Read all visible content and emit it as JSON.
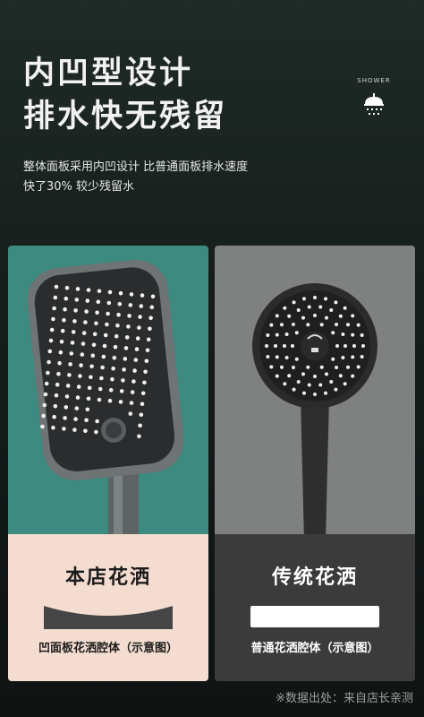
{
  "headline": {
    "line1": "内凹型设计",
    "line2": "排水快无残留"
  },
  "shower_tag": {
    "label": "SHOWER",
    "icon": "shower-icon"
  },
  "description": {
    "line1": "整体面板采用内凹设计 比普通面板排水速度",
    "line2": "快了30% 较少残留水"
  },
  "cards": {
    "left": {
      "title": "本店花洒",
      "caption": "凹面板花洒腔体（示意图）",
      "panel_shape": "concave",
      "colors": {
        "top": "#3d8a80",
        "bottom": "#f4ddd0",
        "panel": "#454545"
      }
    },
    "right": {
      "title": "传统花洒",
      "caption": "普通花洒腔体（示意图）",
      "panel_shape": "flat",
      "colors": {
        "top": "#7f8180",
        "bottom": "#3b3b3b",
        "panel": "#ffffff"
      }
    }
  },
  "footer": {
    "source": "※数据出处：来自店长亲测"
  }
}
